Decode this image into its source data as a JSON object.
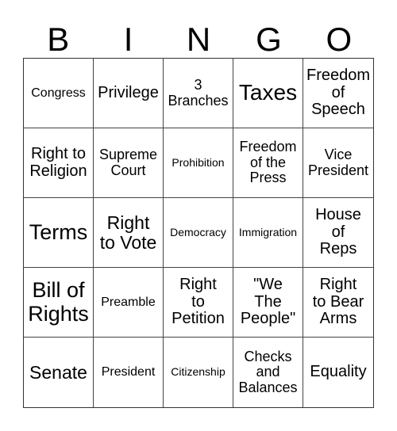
{
  "header": {
    "letters": [
      "B",
      "I",
      "N",
      "G",
      "O"
    ]
  },
  "cells": [
    {
      "text": "Congress"
    },
    {
      "text": "Privilege"
    },
    {
      "text": "3\nBranches"
    },
    {
      "text": "Taxes"
    },
    {
      "text": "Freedom\nof\nSpeech"
    },
    {
      "text": "Right to\nReligion"
    },
    {
      "text": "Supreme\nCourt"
    },
    {
      "text": "Prohibition"
    },
    {
      "text": "Freedom\nof the\nPress"
    },
    {
      "text": "Vice\nPresident"
    },
    {
      "text": "Terms"
    },
    {
      "text": "Right\nto Vote"
    },
    {
      "text": "Democracy"
    },
    {
      "text": "Immigration"
    },
    {
      "text": "House\nof\nReps"
    },
    {
      "text": "Bill of\nRights"
    },
    {
      "text": "Preamble"
    },
    {
      "text": "Right\nto\nPetition"
    },
    {
      "text": "\"We\nThe\nPeople\""
    },
    {
      "text": "Right\nto Bear\nArms"
    },
    {
      "text": "Senate"
    },
    {
      "text": "President"
    },
    {
      "text": "Citizenship"
    },
    {
      "text": "Checks\nand\nBalances"
    },
    {
      "text": "Equality"
    }
  ]
}
